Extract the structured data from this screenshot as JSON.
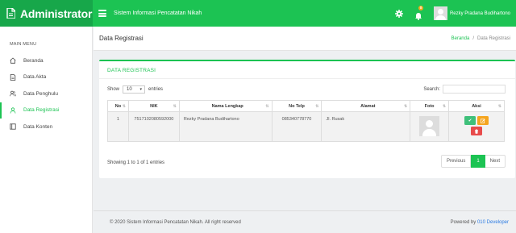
{
  "brand": {
    "title": "Administrator",
    "icon": "file-icon"
  },
  "topbar": {
    "system_title": "Sistem Informasi Pencatatan Nikah",
    "notif_count": "0",
    "user_name": "Rezky Pradana Budihartono"
  },
  "sidebar": {
    "heading": "MAIN MENU",
    "items": [
      {
        "label": "Beranda",
        "icon": "home-icon"
      },
      {
        "label": "Data Akta",
        "icon": "document-icon"
      },
      {
        "label": "Data Penghulu",
        "icon": "users-icon"
      },
      {
        "label": "Data Registrasi",
        "icon": "user-icon",
        "active": true
      },
      {
        "label": "Data Konten",
        "icon": "book-icon"
      }
    ]
  },
  "page": {
    "title": "Data Registrasi",
    "breadcrumb": [
      "Beranda",
      "/",
      "Data Registrasi"
    ]
  },
  "card": {
    "title": "DATA REGISTRASI",
    "show_label": "Show",
    "entries_value": "10",
    "entries_label": "entries",
    "search_label": "Search:"
  },
  "table": {
    "columns": [
      "No",
      "NIK",
      "Nama Lengkap",
      "No Telp",
      "Alamat",
      "Foto",
      "Aksi"
    ],
    "rows": [
      {
        "no": "1",
        "nik": "7517102080592000",
        "nama": "Rezky Pradana Budihartono",
        "telp": "085340778770",
        "alamat": "Jl. Rusak"
      }
    ]
  },
  "pagination": {
    "info": "Showing 1 to 1 of 1 entries",
    "previous": "Previous",
    "current": "1",
    "next": "Next"
  },
  "footer": {
    "copyright": "© 2020 Sistem Informasi Pencatatan Nikah. All right reserved",
    "powered_by": "Powered by",
    "developer": "010 Developer"
  },
  "colors": {
    "primary": "#1cc353",
    "brand_dark": "#17a74a",
    "warning": "#f5a51f",
    "danger": "#e84b4b",
    "success": "#3fc07a"
  }
}
